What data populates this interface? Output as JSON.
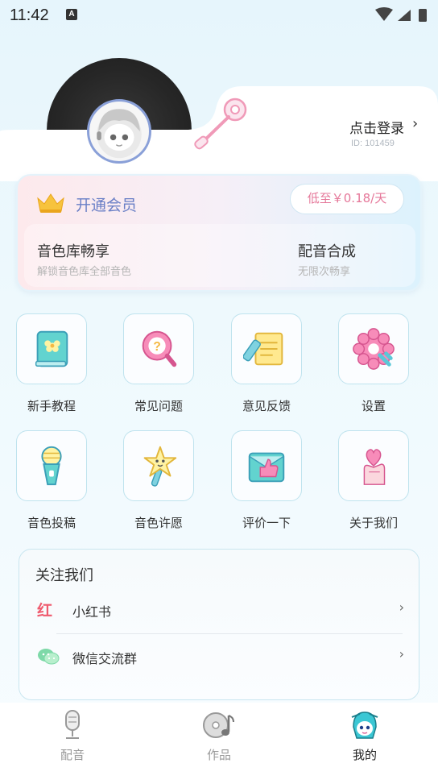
{
  "status_bar": {
    "time": "11:42",
    "notification_badge": "A"
  },
  "profile": {
    "login_text": "点击登录",
    "login_arrow": "›",
    "user_id": "ID: 101459"
  },
  "vip": {
    "title": "开通会员",
    "price_label": "低至￥0.18/天",
    "benefits": [
      {
        "title": "音色库畅享",
        "subtitle": "解锁音色库全部音色"
      },
      {
        "title": "配音合成",
        "subtitle": "无限次畅享"
      }
    ],
    "colors": {
      "title": "#6a7fc6",
      "price": "#e57799"
    }
  },
  "grid": [
    {
      "label": "新手教程",
      "icon": "tutorial-book-icon"
    },
    {
      "label": "常见问题",
      "icon": "question-magnifier-icon"
    },
    {
      "label": "意见反馈",
      "icon": "feedback-note-icon"
    },
    {
      "label": "设置",
      "icon": "settings-gear-icon"
    },
    {
      "label": "音色投稿",
      "icon": "microphone-icon"
    },
    {
      "label": "音色许愿",
      "icon": "star-wand-icon"
    },
    {
      "label": "评价一下",
      "icon": "thumbs-up-icon"
    },
    {
      "label": "关于我们",
      "icon": "heart-hand-icon"
    }
  ],
  "follow": {
    "title": "关注我们",
    "items": [
      {
        "label": "小红书",
        "icon": "xiaohongshu-icon",
        "icon_text": "红"
      },
      {
        "label": "微信交流群",
        "icon": "wechat-icon"
      }
    ],
    "arrow": "›"
  },
  "nav": {
    "items": [
      {
        "label": "配音",
        "icon": "microphone-nav-icon",
        "active": false
      },
      {
        "label": "作品",
        "icon": "music-disc-icon",
        "active": false
      },
      {
        "label": "我的",
        "icon": "mascot-icon",
        "active": true
      }
    ]
  }
}
